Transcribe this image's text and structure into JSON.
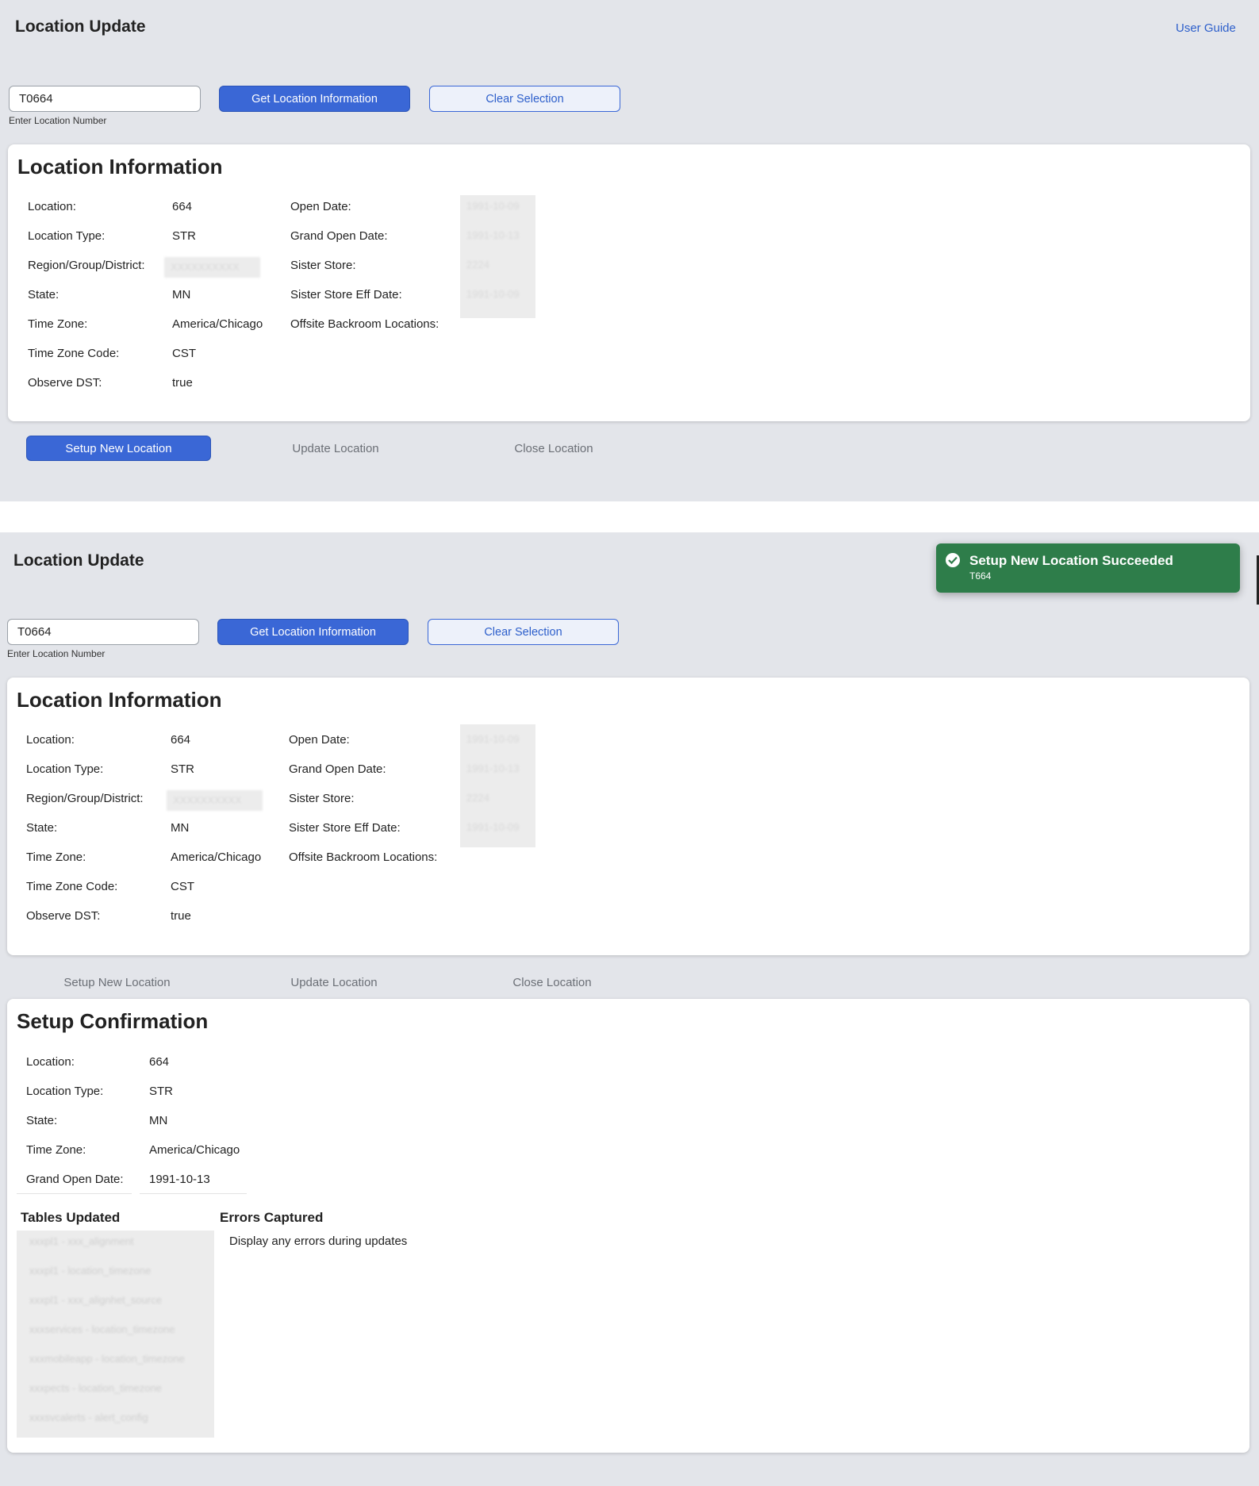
{
  "app_title": "Location Update",
  "user_guide_label": "User Guide",
  "search": {
    "value": "T0664",
    "hint": "Enter Location Number",
    "get_label": "Get Location Information",
    "clear_label": "Clear Selection"
  },
  "info": {
    "title": "Location Information",
    "location_label": "Location:",
    "location_value": "664",
    "type_label": "Location Type:",
    "type_value": "STR",
    "region_label": "Region/Group/District:",
    "region_value": "XXXXXXXXXX",
    "state_label": "State:",
    "state_value": "MN",
    "tz_label": "Time Zone:",
    "tz_value": "America/Chicago",
    "tzcode_label": "Time Zone Code:",
    "tzcode_value": "CST",
    "dst_label": "Observe DST:",
    "dst_value": "true",
    "open_label": "Open Date:",
    "open_value": "1991-10-09",
    "grand_label": "Grand Open Date:",
    "grand_value": "1991-10-13",
    "sister_label": "Sister Store:",
    "sister_value": "2224",
    "sister_eff_label": "Sister Store Eff Date:",
    "sister_eff_value": "1991-10-09",
    "offsite_label": "Offsite Backroom Locations:"
  },
  "actions": {
    "setup": "Setup New Location",
    "update": "Update Location",
    "close": "Close Location",
    "active_first": "Setup New Location"
  },
  "toast": {
    "title": "Setup New Location Succeeded",
    "sub": "T664",
    "color": "#2e7d4a"
  },
  "confirm": {
    "title": "Setup Confirmation",
    "location_label": "Location:",
    "location_value": "664",
    "type_label": "Location Type:",
    "type_value": "STR",
    "state_label": "State:",
    "state_value": "MN",
    "tz_label": "Time Zone:",
    "tz_value": "America/Chicago",
    "grand_label": "Grand Open Date:",
    "grand_value": "1991-10-13",
    "tables_heading": "Tables Updated",
    "errors_heading": "Errors Captured",
    "errors_text": "Display any errors during updates",
    "tables": [
      "xxxpl1 - xxx_alignment",
      "xxxpl1 - location_timezone",
      "xxxpl1 - xxx_alignhet_source",
      "xxxservices - location_timezone",
      "xxxmobileapp - location_timezone",
      "xxxpects - location_timezone",
      "xxxsvcalerts - alert_config"
    ]
  },
  "colors": {
    "accent": "#3a67d6",
    "background": "#e3e5ea",
    "success": "#2e7d4a"
  }
}
